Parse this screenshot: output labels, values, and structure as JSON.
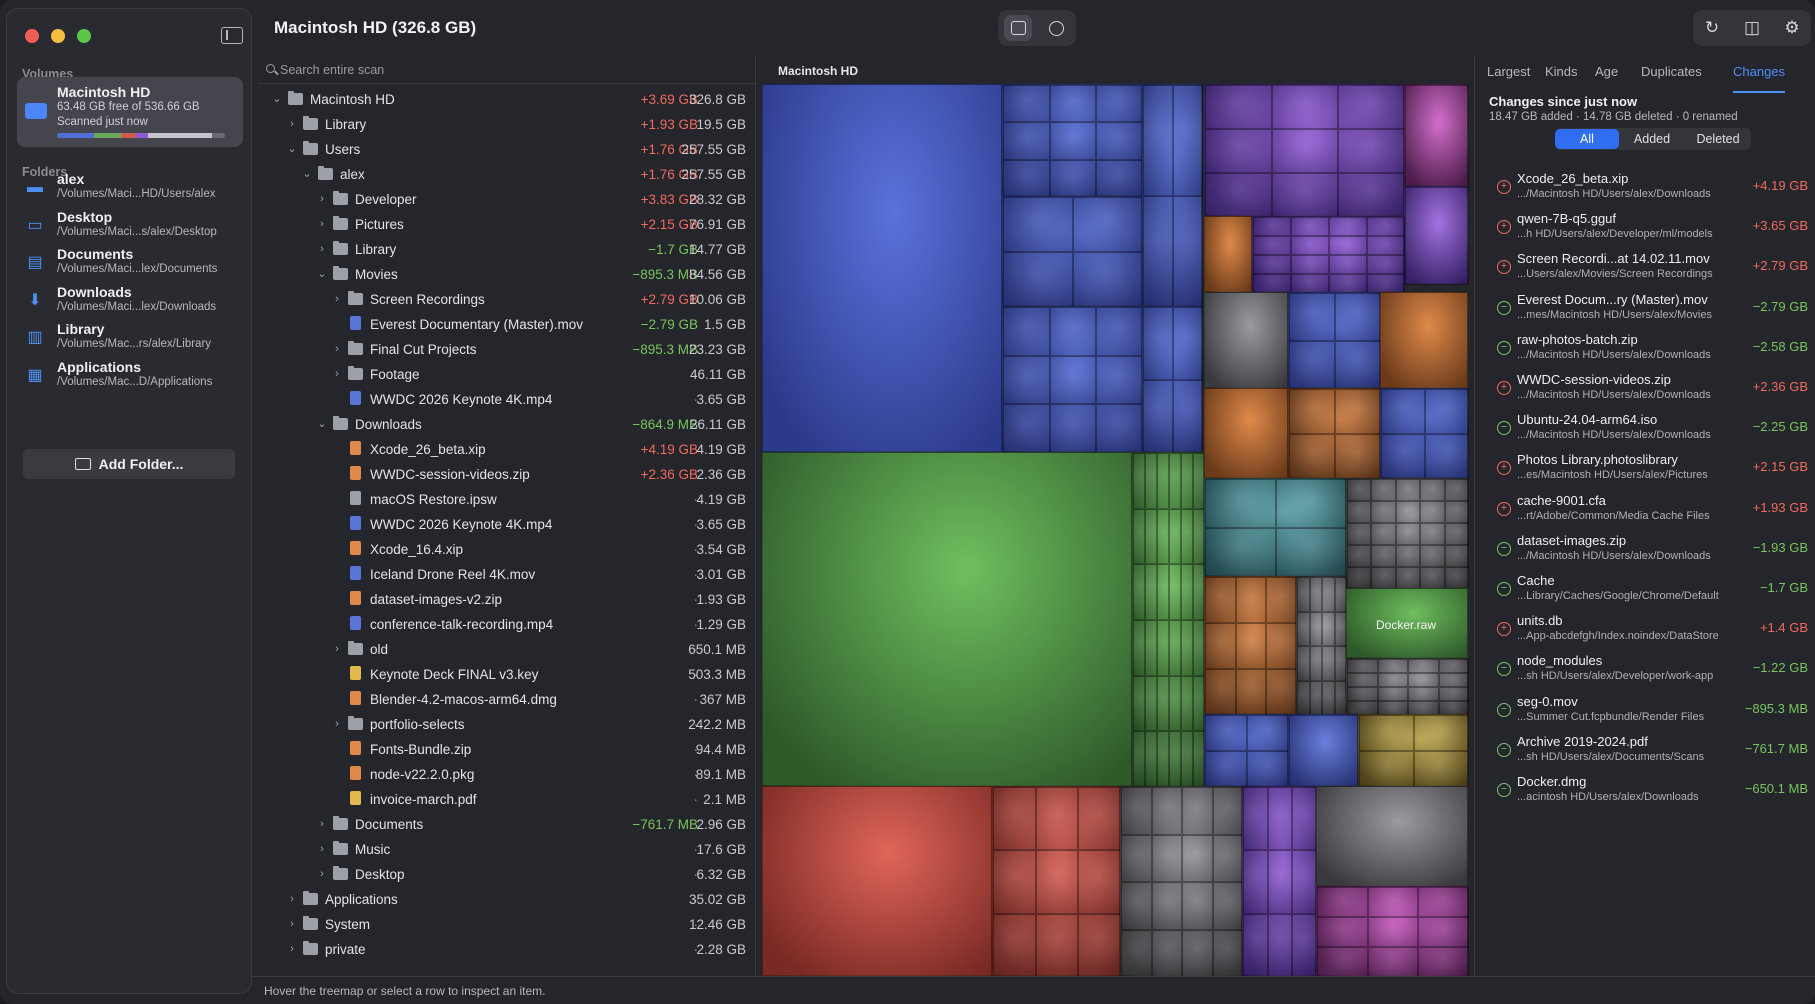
{
  "sidebar": {
    "volumes_label": "Volumes",
    "folders_label": "Folders",
    "volume": {
      "title": "Macintosh HD",
      "free": "63.48 GB free of 536.66 GB",
      "scanned": "Scanned just now",
      "usage_segments": [
        {
          "color": "#4f6fd6",
          "fraction": 0.22
        },
        {
          "color": "#6aa85a",
          "fraction": 0.16
        },
        {
          "color": "#d25b4f",
          "fraction": 0.09
        },
        {
          "color": "#8d59d4",
          "fraction": 0.07
        },
        {
          "color": "#c5c6cb",
          "fraction": 0.38
        }
      ]
    },
    "folders": [
      {
        "name": "alex",
        "path": "/Volumes/Maci...HD/Users/alex",
        "icon": "folder-icon"
      },
      {
        "name": "Desktop",
        "path": "/Volumes/Maci...s/alex/Desktop",
        "icon": "desktop-icon"
      },
      {
        "name": "Documents",
        "path": "/Volumes/Maci...lex/Documents",
        "icon": "document-icon"
      },
      {
        "name": "Downloads",
        "path": "/Volumes/Maci...lex/Downloads",
        "icon": "download-icon"
      },
      {
        "name": "Library",
        "path": "/Volumes/Mac...rs/alex/Library",
        "icon": "library-icon"
      },
      {
        "name": "Applications",
        "path": "/Volumes/Mac...D/Applications",
        "icon": "applications-icon"
      }
    ],
    "add_folder": "Add Folder..."
  },
  "toolbar": {
    "title": "Macintosh HD (326.8 GB)"
  },
  "tree": {
    "search_placeholder": "Search entire scan",
    "rows": [
      {
        "name": "Macintosh HD",
        "depth": 0,
        "chevron": "down",
        "kind": "folder",
        "delta": "+3.69 GB",
        "sign": "pos",
        "size": "326.8 GB"
      },
      {
        "name": "Library",
        "depth": 1,
        "chevron": "right",
        "kind": "folder",
        "delta": "+1.93 GB",
        "sign": "pos",
        "size": "19.5 GB"
      },
      {
        "name": "Users",
        "depth": 1,
        "chevron": "down",
        "kind": "folder",
        "delta": "+1.76 GB",
        "sign": "pos",
        "size": "257.55 GB"
      },
      {
        "name": "alex",
        "depth": 2,
        "chevron": "down",
        "kind": "folder",
        "delta": "+1.76 GB",
        "sign": "pos",
        "size": "257.55 GB"
      },
      {
        "name": "Developer",
        "depth": 3,
        "chevron": "right",
        "kind": "folder",
        "delta": "+3.83 GB",
        "sign": "pos",
        "size": "28.32 GB"
      },
      {
        "name": "Pictures",
        "depth": 3,
        "chevron": "right",
        "kind": "folder",
        "delta": "+2.15 GB",
        "sign": "pos",
        "size": "76.91 GB"
      },
      {
        "name": "Library",
        "depth": 3,
        "chevron": "right",
        "kind": "folder",
        "delta": "−1.7 GB",
        "sign": "neg",
        "size": "14.77 GB"
      },
      {
        "name": "Movies",
        "depth": 3,
        "chevron": "down",
        "kind": "folder",
        "delta": "−895.3 MB",
        "sign": "neg",
        "size": "84.56 GB"
      },
      {
        "name": "Screen Recordings",
        "depth": 4,
        "chevron": "right",
        "kind": "folder",
        "delta": "+2.79 GB",
        "sign": "pos",
        "size": "10.06 GB"
      },
      {
        "name": "Everest Documentary (Master).mov",
        "depth": 4,
        "chevron": "",
        "kind": "video",
        "delta": "−2.79 GB",
        "sign": "neg",
        "size": "1.5 GB"
      },
      {
        "name": "Final Cut Projects",
        "depth": 4,
        "chevron": "right",
        "kind": "folder",
        "delta": "−895.3 MB",
        "sign": "neg",
        "size": "23.23 GB"
      },
      {
        "name": "Footage",
        "depth": 4,
        "chevron": "right",
        "kind": "folder",
        "delta": "·",
        "sign": "neu",
        "size": "46.11 GB"
      },
      {
        "name": "WWDC 2026 Keynote 4K.mp4",
        "depth": 4,
        "chevron": "",
        "kind": "video",
        "delta": "·",
        "sign": "neu",
        "size": "3.65 GB"
      },
      {
        "name": "Downloads",
        "depth": 3,
        "chevron": "down",
        "kind": "folder",
        "delta": "−864.9 MB",
        "sign": "neg",
        "size": "26.11 GB"
      },
      {
        "name": "Xcode_26_beta.xip",
        "depth": 4,
        "chevron": "",
        "kind": "archive",
        "delta": "+4.19 GB",
        "sign": "pos",
        "size": "4.19 GB"
      },
      {
        "name": "WWDC-session-videos.zip",
        "depth": 4,
        "chevron": "",
        "kind": "archive",
        "delta": "+2.36 GB",
        "sign": "pos",
        "size": "2.36 GB"
      },
      {
        "name": "macOS Restore.ipsw",
        "depth": 4,
        "chevron": "",
        "kind": "file",
        "delta": "·",
        "sign": "neu",
        "size": "4.19 GB"
      },
      {
        "name": "WWDC 2026 Keynote 4K.mp4",
        "depth": 4,
        "chevron": "",
        "kind": "video",
        "delta": "·",
        "sign": "neu",
        "size": "3.65 GB"
      },
      {
        "name": "Xcode_16.4.xip",
        "depth": 4,
        "chevron": "",
        "kind": "archive",
        "delta": "·",
        "sign": "neu",
        "size": "3.54 GB"
      },
      {
        "name": "Iceland Drone Reel 4K.mov",
        "depth": 4,
        "chevron": "",
        "kind": "video",
        "delta": "·",
        "sign": "neu",
        "size": "3.01 GB"
      },
      {
        "name": "dataset-images-v2.zip",
        "depth": 4,
        "chevron": "",
        "kind": "archive",
        "delta": "·",
        "sign": "neu",
        "size": "1.93 GB"
      },
      {
        "name": "conference-talk-recording.mp4",
        "depth": 4,
        "chevron": "",
        "kind": "video",
        "delta": "·",
        "sign": "neu",
        "size": "1.29 GB"
      },
      {
        "name": "old",
        "depth": 4,
        "chevron": "right",
        "kind": "folder",
        "delta": "·",
        "sign": "neu",
        "size": "650.1 MB"
      },
      {
        "name": "Keynote Deck FINAL v3.key",
        "depth": 4,
        "chevron": "",
        "kind": "doc",
        "delta": "·",
        "sign": "neu",
        "size": "503.3 MB"
      },
      {
        "name": "Blender-4.2-macos-arm64.dmg",
        "depth": 4,
        "chevron": "",
        "kind": "archive",
        "delta": "·",
        "sign": "neu",
        "size": "367 MB"
      },
      {
        "name": "portfolio-selects",
        "depth": 4,
        "chevron": "right",
        "kind": "folder",
        "delta": "·",
        "sign": "neu",
        "size": "242.2 MB"
      },
      {
        "name": "Fonts-Bundle.zip",
        "depth": 4,
        "chevron": "",
        "kind": "archive",
        "delta": "·",
        "sign": "neu",
        "size": "94.4 MB"
      },
      {
        "name": "node-v22.2.0.pkg",
        "depth": 4,
        "chevron": "",
        "kind": "archive",
        "delta": "·",
        "sign": "neu",
        "size": "89.1 MB"
      },
      {
        "name": "invoice-march.pdf",
        "depth": 4,
        "chevron": "",
        "kind": "doc",
        "delta": "·",
        "sign": "neu",
        "size": "2.1 MB"
      },
      {
        "name": "Documents",
        "depth": 3,
        "chevron": "right",
        "kind": "folder",
        "delta": "−761.7 MB",
        "sign": "neg",
        "size": "2.96 GB"
      },
      {
        "name": "Music",
        "depth": 3,
        "chevron": "right",
        "kind": "folder",
        "delta": "·",
        "sign": "neu",
        "size": "17.6 GB"
      },
      {
        "name": "Desktop",
        "depth": 3,
        "chevron": "right",
        "kind": "folder",
        "delta": "·",
        "sign": "neu",
        "size": "6.32 GB"
      },
      {
        "name": "Applications",
        "depth": 1,
        "chevron": "right",
        "kind": "folder",
        "delta": "·",
        "sign": "neu",
        "size": "35.02 GB"
      },
      {
        "name": "System",
        "depth": 1,
        "chevron": "right",
        "kind": "folder",
        "delta": "·",
        "sign": "neu",
        "size": "12.46 GB"
      },
      {
        "name": "private",
        "depth": 1,
        "chevron": "right",
        "kind": "folder",
        "delta": "·",
        "sign": "neu",
        "size": "2.28 GB"
      }
    ]
  },
  "treemap": {
    "title": "Macintosh HD",
    "label": "Docker.raw"
  },
  "changes": {
    "tabs": [
      "Largest",
      "Kinds",
      "Age",
      "Duplicates",
      "Changes"
    ],
    "active_tab": "Changes",
    "title": "Changes since just now",
    "summary": "18.47 GB added · 14.78 GB deleted · 0 renamed",
    "filters": [
      "All",
      "Added",
      "Deleted"
    ],
    "active_filter": "All",
    "items": [
      {
        "name": "Xcode_26_beta.xip",
        "path": ".../Macintosh HD/Users/alex/Downloads",
        "delta": "+4.19 GB",
        "sign": "pos"
      },
      {
        "name": "qwen-7B-q5.gguf",
        "path": "...h HD/Users/alex/Developer/ml/models",
        "delta": "+3.65 GB",
        "sign": "pos"
      },
      {
        "name": "Screen Recordi...at 14.02.11.mov",
        "path": "...Users/alex/Movies/Screen Recordings",
        "delta": "+2.79 GB",
        "sign": "pos"
      },
      {
        "name": "Everest Docum...ry (Master).mov",
        "path": "...mes/Macintosh HD/Users/alex/Movies",
        "delta": "−2.79 GB",
        "sign": "neg"
      },
      {
        "name": "raw-photos-batch.zip",
        "path": ".../Macintosh HD/Users/alex/Downloads",
        "delta": "−2.58 GB",
        "sign": "neg"
      },
      {
        "name": "WWDC-session-videos.zip",
        "path": ".../Macintosh HD/Users/alex/Downloads",
        "delta": "+2.36 GB",
        "sign": "pos"
      },
      {
        "name": "Ubuntu-24.04-arm64.iso",
        "path": ".../Macintosh HD/Users/alex/Downloads",
        "delta": "−2.25 GB",
        "sign": "neg"
      },
      {
        "name": "Photos Library.photoslibrary",
        "path": "...es/Macintosh HD/Users/alex/Pictures",
        "delta": "+2.15 GB",
        "sign": "pos"
      },
      {
        "name": "cache-9001.cfa",
        "path": "...rt/Adobe/Common/Media Cache Files",
        "delta": "+1.93 GB",
        "sign": "pos"
      },
      {
        "name": "dataset-images.zip",
        "path": ".../Macintosh HD/Users/alex/Downloads",
        "delta": "−1.93 GB",
        "sign": "neg"
      },
      {
        "name": "Cache",
        "path": "...Library/Caches/Google/Chrome/Default",
        "delta": "−1.7 GB",
        "sign": "neg"
      },
      {
        "name": "units.db",
        "path": "...App-abcdefgh/Index.noindex/DataStore",
        "delta": "+1.4 GB",
        "sign": "pos"
      },
      {
        "name": "node_modules",
        "path": "...sh HD/Users/alex/Developer/work-app",
        "delta": "−1.22 GB",
        "sign": "neg"
      },
      {
        "name": "seg-0.mov",
        "path": "...Summer Cut.fcpbundle/Render Files",
        "delta": "−895.3 MB",
        "sign": "neg"
      },
      {
        "name": "Archive 2019-2024.pdf",
        "path": "...sh HD/Users/alex/Documents/Scans",
        "delta": "−761.7 MB",
        "sign": "neg"
      },
      {
        "name": "Docker.dmg",
        "path": "...acintosh HD/Users/alex/Downloads",
        "delta": "−650.1 MB",
        "sign": "neg"
      }
    ]
  },
  "status": {
    "text": "Hover the treemap or select a row to inspect an item."
  },
  "colors": {
    "accent": "#4c90f7",
    "added": "#ef6a5f",
    "deleted": "#78c45f"
  }
}
